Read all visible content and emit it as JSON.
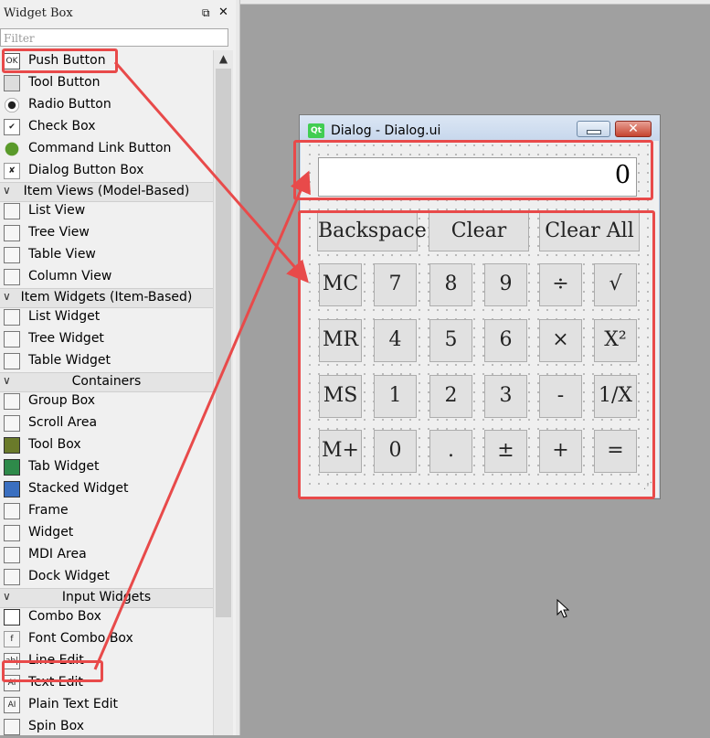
{
  "widget_box": {
    "title": "Widget Box",
    "float_glyph": "⧉",
    "close_glyph": "✕",
    "filter_placeholder": "Filter",
    "scroll_up": "▲",
    "items_top": [
      {
        "label": "Push Button",
        "icon": "push-button-icon"
      },
      {
        "label": "Tool Button",
        "icon": "tool-button-icon"
      },
      {
        "label": "Radio Button",
        "icon": "radio-button-icon"
      },
      {
        "label": "Check Box",
        "icon": "check-box-icon"
      },
      {
        "label": "Command Link Button",
        "icon": "command-link-icon"
      },
      {
        "label": "Dialog Button Box",
        "icon": "dialog-button-box-icon"
      }
    ],
    "categories": [
      {
        "label": "Item Views (Model-Based)",
        "items": [
          "List View",
          "Tree View",
          "Table View",
          "Column View"
        ]
      },
      {
        "label": "Item Widgets (Item-Based)",
        "items": [
          "List Widget",
          "Tree Widget",
          "Table Widget"
        ]
      },
      {
        "label": "Containers",
        "items": [
          "Group Box",
          "Scroll Area",
          "Tool Box",
          "Tab Widget",
          "Stacked Widget",
          "Frame",
          "Widget",
          "MDI Area",
          "Dock Widget"
        ]
      },
      {
        "label": "Input Widgets",
        "items": [
          "Combo Box",
          "Font Combo Box",
          "Line Edit",
          "Text Edit",
          "Plain Text Edit",
          "Spin Box"
        ]
      }
    ],
    "collapse_glyph": "∨"
  },
  "dialog": {
    "title": "Dialog - Dialog.ui",
    "qt_logo": "Qt",
    "close_glyph": "✕",
    "display_value": "0",
    "buttons": [
      [
        "Backspace",
        "Clear",
        "Clear All"
      ],
      [
        "MC",
        "7",
        "8",
        "9",
        "÷",
        "√"
      ],
      [
        "MR",
        "4",
        "5",
        "6",
        "×",
        "X²"
      ],
      [
        "MS",
        "1",
        "2",
        "3",
        "-",
        "1/X"
      ],
      [
        "M+",
        "0",
        ".",
        "±",
        "+",
        "="
      ]
    ]
  },
  "colors": {
    "highlight": "#e84a4a",
    "canvas": "#a0a0a0",
    "dialog_bg": "#f0f0f0"
  }
}
